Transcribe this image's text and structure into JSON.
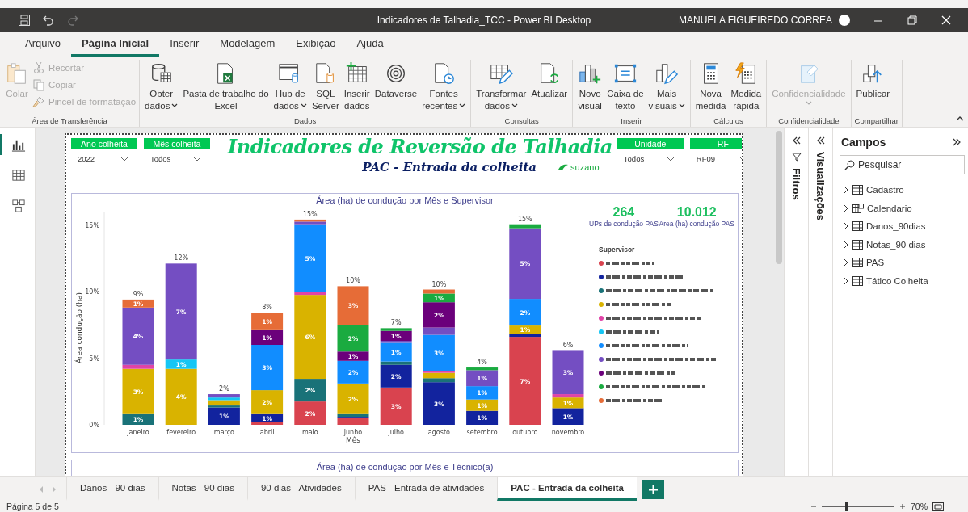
{
  "window": {
    "title": "Indicadores de Talhadia_TCC - Power BI Desktop",
    "user": "MANUELA FIGUEIREDO CORREA"
  },
  "menu_tabs": [
    {
      "label": "Arquivo",
      "selected": false
    },
    {
      "label": "Página Inicial",
      "selected": true
    },
    {
      "label": "Inserir",
      "selected": false
    },
    {
      "label": "Modelagem",
      "selected": false
    },
    {
      "label": "Exibição",
      "selected": false
    },
    {
      "label": "Ajuda",
      "selected": false
    }
  ],
  "ribbon": [
    {
      "label": "Área de Transferência",
      "items": [
        {
          "kind": "large",
          "lines": [
            "Colar"
          ],
          "disabled": true,
          "dropdown": false
        },
        {
          "kind": "small",
          "lines": [
            "Recortar"
          ],
          "disabled": true
        },
        {
          "kind": "small",
          "lines": [
            "Copiar"
          ],
          "disabled": true
        },
        {
          "kind": "small",
          "lines": [
            "Pincel de formatação"
          ],
          "disabled": true
        }
      ]
    },
    {
      "label": "Dados",
      "items": [
        {
          "kind": "large",
          "lines": [
            "Obter",
            "dados"
          ],
          "disabled": false,
          "dropdown": true
        },
        {
          "kind": "large",
          "lines": [
            "Pasta de trabalho do",
            "Excel"
          ],
          "disabled": false,
          "dropdown": false
        },
        {
          "kind": "large",
          "lines": [
            "Hub de",
            "dados"
          ],
          "disabled": false,
          "dropdown": true
        },
        {
          "kind": "large",
          "lines": [
            "SQL",
            "Server"
          ],
          "disabled": false,
          "dropdown": false
        },
        {
          "kind": "large",
          "lines": [
            "Inserir",
            "dados"
          ],
          "disabled": false,
          "dropdown": false
        },
        {
          "kind": "large",
          "lines": [
            "Dataverse"
          ],
          "disabled": false,
          "dropdown": false
        },
        {
          "kind": "large",
          "lines": [
            "Fontes",
            "recentes"
          ],
          "disabled": false,
          "dropdown": true
        }
      ]
    },
    {
      "label": "Consultas",
      "items": [
        {
          "kind": "large",
          "lines": [
            "Transformar",
            "dados"
          ],
          "disabled": false,
          "dropdown": true
        },
        {
          "kind": "large",
          "lines": [
            "Atualizar"
          ],
          "disabled": false,
          "dropdown": false
        }
      ]
    },
    {
      "label": "Inserir",
      "items": [
        {
          "kind": "large",
          "lines": [
            "Novo",
            "visual"
          ],
          "disabled": false,
          "dropdown": false
        },
        {
          "kind": "large",
          "lines": [
            "Caixa de",
            "texto"
          ],
          "disabled": false,
          "dropdown": false
        },
        {
          "kind": "large",
          "lines": [
            "Mais",
            "visuais"
          ],
          "disabled": false,
          "dropdown": true
        }
      ]
    },
    {
      "label": "Cálculos",
      "items": [
        {
          "kind": "large",
          "lines": [
            "Nova",
            "medida"
          ],
          "disabled": false,
          "dropdown": false
        },
        {
          "kind": "large",
          "lines": [
            "Medida",
            "rápida"
          ],
          "disabled": false,
          "dropdown": false
        }
      ]
    },
    {
      "label": "Confidencialidade",
      "items": [
        {
          "kind": "large",
          "lines": [
            "Confidencialidade"
          ],
          "disabled": true,
          "dropdown": true
        }
      ]
    },
    {
      "label": "Compartilhar",
      "items": [
        {
          "kind": "large",
          "lines": [
            "Publicar"
          ],
          "disabled": false,
          "dropdown": false
        }
      ]
    }
  ],
  "views": [
    {
      "selected": true
    },
    {
      "selected": false
    },
    {
      "selected": false
    }
  ],
  "page": {
    "slicers_left": [
      {
        "label": "Ano colheita",
        "value": "2022"
      },
      {
        "label": "Mês colheita",
        "value": "Todos"
      }
    ],
    "title": "Indicadores de Reversão de Talhadia",
    "subtitle": "PAC - Entrada da colheita",
    "logo": "suzano",
    "slicers_right": [
      {
        "label": "Unidade",
        "value": "Todos"
      },
      {
        "label": "RF",
        "value": "RF09"
      }
    ],
    "chart_title": "Área (ha) de condução por Mês e Supervisor",
    "kpis": [
      {
        "value": "264",
        "label": "UPs de condução PAS"
      },
      {
        "value": "10.012",
        "label": "Área (ha) condução PAS"
      }
    ],
    "legend_title": "Supervisor",
    "chart_data": {
      "type": "bar",
      "stacked": true,
      "orientation": "vertical",
      "xlabel": "Mês",
      "ylabel": "Área condução (ha)",
      "ylim": [
        0,
        16
      ],
      "yticks": [
        {
          "value": 0,
          "label": "0%"
        },
        {
          "value": 5,
          "label": "5%"
        },
        {
          "value": 10,
          "label": "10%"
        },
        {
          "value": 15,
          "label": "15%"
        }
      ],
      "categories": [
        "janeiro",
        "fevereiro",
        "março",
        "abril",
        "maio",
        "junho",
        "julho",
        "agosto",
        "setembro",
        "outubro",
        "novembro"
      ],
      "series": [
        {
          "color": "#d9434f",
          "values": [
            null,
            null,
            null,
            0.2,
            1.75,
            0.5,
            2.8,
            null,
            null,
            6.6,
            null
          ],
          "value_labels": [
            null,
            null,
            null,
            null,
            "2%",
            null,
            "3%",
            null,
            null,
            "7%",
            null
          ]
        },
        {
          "color": "#12239e",
          "values": [
            null,
            null,
            1.3,
            0.6,
            null,
            0.1,
            1.7,
            3.2,
            1.05,
            0.2,
            1.25
          ],
          "value_labels": [
            null,
            null,
            "1%",
            "1%",
            null,
            null,
            "2%",
            "3%",
            "1%",
            null,
            "1%"
          ]
        },
        {
          "color": "#197278",
          "values": [
            0.8,
            null,
            0.15,
            null,
            1.7,
            0.2,
            0.25,
            0.3,
            null,
            null,
            null
          ],
          "value_labels": [
            "1%",
            null,
            null,
            null,
            "2%",
            null,
            null,
            null,
            null,
            null,
            null
          ]
        },
        {
          "color": "#d9b300",
          "values": [
            3.4,
            4.2,
            0.4,
            1.8,
            6.3,
            2.3,
            null,
            0.4,
            0.85,
            0.65,
            0.8
          ],
          "value_labels": [
            "3%",
            "4%",
            null,
            "2%",
            "6%",
            "2%",
            null,
            null,
            "1%",
            "1%",
            "1%"
          ]
        },
        {
          "color": "#e044a7",
          "values": [
            0.3,
            null,
            null,
            null,
            0.2,
            null,
            null,
            0.1,
            null,
            null,
            0.25
          ],
          "value_labels": [
            null,
            null,
            null,
            null,
            null,
            null,
            null,
            null,
            null,
            null,
            null
          ]
        },
        {
          "color": "#15c6f4",
          "values": [
            null,
            0.7,
            0.2,
            null,
            null,
            null,
            null,
            null,
            null,
            null,
            null
          ],
          "value_labels": [
            null,
            "1%",
            null,
            null,
            null,
            null,
            null,
            null,
            null,
            null,
            null
          ]
        },
        {
          "color": "#118dff",
          "values": [
            null,
            null,
            null,
            3.4,
            5.1,
            1.7,
            1.4,
            2.75,
            1.0,
            2.0,
            null
          ],
          "value_labels": [
            null,
            null,
            null,
            "3%",
            "5%",
            "2%",
            "1%",
            "3%",
            "1%",
            "2%",
            null
          ]
        },
        {
          "color": "#744ec2",
          "values": [
            4.3,
            7.2,
            0.25,
            null,
            0.2,
            null,
            0.15,
            0.55,
            1.2,
            5.3,
            3.25
          ],
          "value_labels": [
            "4%",
            "7%",
            null,
            null,
            null,
            null,
            null,
            null,
            "1%",
            "5%",
            "3%"
          ]
        },
        {
          "color": "#6b007b",
          "values": [
            null,
            null,
            null,
            1.1,
            null,
            0.7,
            0.75,
            1.9,
            null,
            null,
            null
          ],
          "value_labels": [
            null,
            null,
            null,
            "1%",
            null,
            "1%",
            "1%",
            "2%",
            null,
            null,
            null
          ]
        },
        {
          "color": "#1aab40",
          "values": [
            null,
            null,
            null,
            null,
            null,
            2.0,
            0.2,
            0.65,
            0.2,
            0.3,
            null
          ],
          "value_labels": [
            null,
            null,
            null,
            null,
            null,
            "2%",
            null,
            "1%",
            null,
            null,
            null
          ]
        },
        {
          "color": "#e66c37",
          "values": [
            0.6,
            null,
            null,
            1.3,
            0.15,
            2.9,
            null,
            0.3,
            null,
            null,
            null
          ],
          "value_labels": [
            "1%",
            null,
            null,
            "1%",
            null,
            "3%",
            null,
            null,
            null,
            null,
            null
          ]
        }
      ],
      "annotations": [
        {
          "x": "janeiro",
          "y": 9.4,
          "text": "9%"
        },
        {
          "x": "fevereiro",
          "y": 12.1,
          "text": "12%"
        },
        {
          "x": "março",
          "y": 2.3,
          "text": "2%"
        },
        {
          "x": "abril",
          "y": 8.4,
          "text": "8%"
        },
        {
          "x": "maio",
          "y": 15.4,
          "text": "15%"
        },
        {
          "x": "junho",
          "y": 10.4,
          "text": "10%"
        },
        {
          "x": "julho",
          "y": 7.25,
          "text": "7%"
        },
        {
          "x": "agosto",
          "y": 10.15,
          "text": "10%"
        },
        {
          "x": "setembro",
          "y": 4.3,
          "text": "4%"
        },
        {
          "x": "outubro",
          "y": 15.05,
          "text": "15%"
        },
        {
          "x": "novembro",
          "y": 5.55,
          "text": "6%"
        }
      ]
    },
    "second_chart_title": "Área (ha) de condução por Mês e Técnico(a)"
  },
  "filters_pane": {
    "label": "Filtros"
  },
  "visualizations_pane": {
    "label": "Visualizações"
  },
  "fields_pane": {
    "title": "Campos",
    "search_placeholder": "Pesquisar",
    "tables": [
      {
        "name": "Cadastro",
        "kind": "table",
        "expanded": false
      },
      {
        "name": "Calendario",
        "kind": "date_table",
        "expanded": false
      },
      {
        "name": "Danos_90dias",
        "kind": "table",
        "expanded": false
      },
      {
        "name": "Notas_90 dias",
        "kind": "table",
        "expanded": false
      },
      {
        "name": "PAS",
        "kind": "table",
        "expanded": false
      },
      {
        "name": "Tático Colheita",
        "kind": "table",
        "expanded": false
      }
    ]
  },
  "page_tabs": [
    {
      "label": "Danos - 90 dias",
      "selected": false
    },
    {
      "label": "Notas - 90 dias",
      "selected": false
    },
    {
      "label": "90 dias - Atividades",
      "selected": false
    },
    {
      "label": "PAS - Entrada de atividades",
      "selected": false
    },
    {
      "label": "PAC - Entrada da colheita",
      "selected": true
    }
  ],
  "status_bar": {
    "page": "Página 5 de 5",
    "zoom": "70%",
    "zoom_slider": {
      "level": 0.35
    }
  }
}
